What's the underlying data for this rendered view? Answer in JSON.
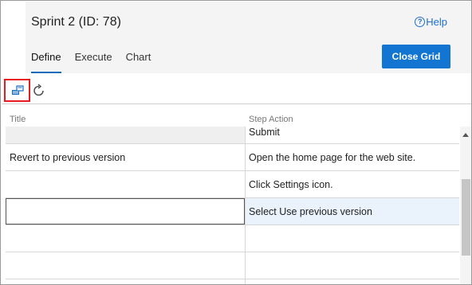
{
  "header": {
    "title": "Sprint 2 (ID: 78)",
    "help_label": "Help",
    "help_glyph": "?"
  },
  "tabs": [
    {
      "label": "Define",
      "active": true
    },
    {
      "label": "Execute",
      "active": false
    },
    {
      "label": "Chart",
      "active": false
    }
  ],
  "actions": {
    "close_grid_label": "Close Grid"
  },
  "toolbar": {
    "icons": [
      "open-in-client-icon",
      "refresh-icon"
    ]
  },
  "grid": {
    "columns": [
      "Title",
      "Step Action"
    ],
    "rows": [
      {
        "title": "",
        "step_action": "Submit"
      },
      {
        "title": "Revert to previous version",
        "step_action": "Open the home page for the web site."
      },
      {
        "title": "",
        "step_action": "Click Settings icon."
      },
      {
        "title": "",
        "step_action": "Select Use previous version"
      },
      {
        "title": "",
        "step_action": ""
      },
      {
        "title": "",
        "step_action": ""
      }
    ]
  },
  "colors": {
    "accent": "#1275d1",
    "highlight_border": "#e81b23",
    "selected_row": "#eaf3fc"
  }
}
